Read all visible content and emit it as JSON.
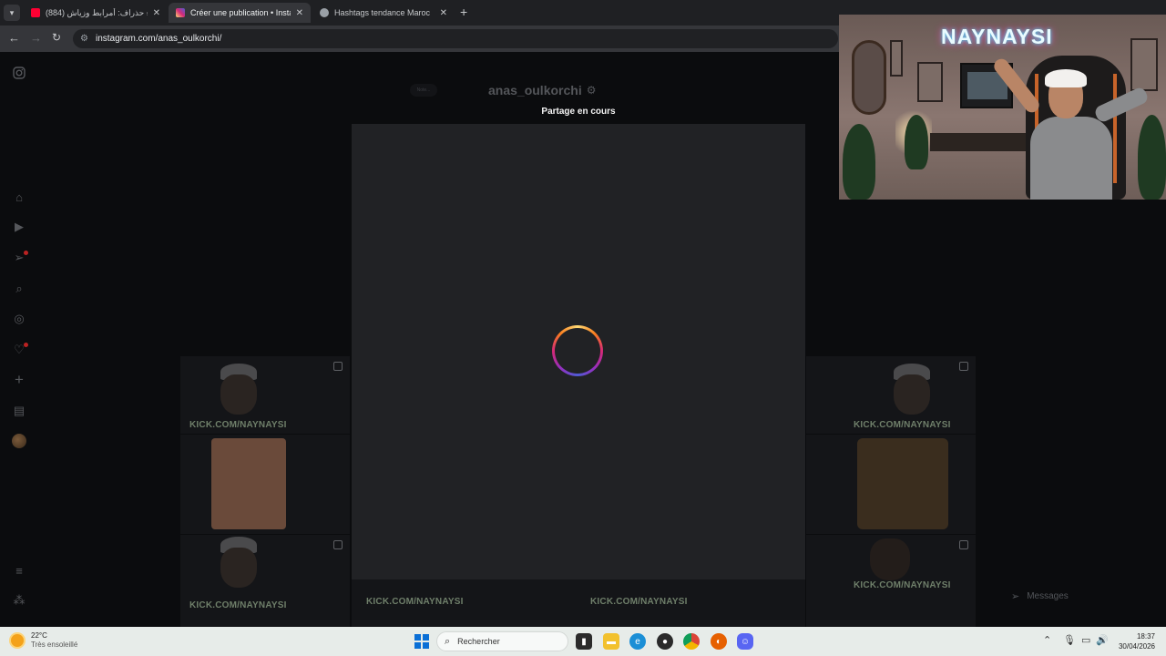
{
  "browser": {
    "tabs": [
      {
        "title": "(884) زكرياء حذراف: أمرابط وزياش",
        "active": false,
        "favicon_color": "#ff0033"
      },
      {
        "title": "Créer une publication • Instagram",
        "active": true,
        "favicon_color": "#d62976"
      },
      {
        "title": "Hashtags tendance Maroc",
        "active": false,
        "favicon_color": "#9aa0a6"
      }
    ],
    "new_tab_label": "+",
    "url": "instagram.com/anas_oulkorchi/"
  },
  "instagram": {
    "username": "anas_oulkorchi",
    "note_placeholder": "Note...",
    "modal_title": "Partage en cours",
    "watermark": "KICK.COM/NAYNAYSI",
    "messages_label": "Messages",
    "sidebar_icons": [
      "instagram-logo-icon",
      "home-icon",
      "reels-icon",
      "messages-icon",
      "search-icon",
      "explore-icon",
      "notifications-icon",
      "create-icon",
      "dashboard-icon",
      "profile-avatar",
      "menu-icon",
      "threads-icon"
    ]
  },
  "webcam": {
    "brand": "NAYNAYSI"
  },
  "taskbar": {
    "temperature": "22°C",
    "weather": "Très ensoleillé",
    "search_placeholder": "Rechercher",
    "time": "18:37",
    "date": "30/04/2026"
  },
  "colors": {
    "page_bg": "#0b0c0e",
    "modal_bg": "#212225",
    "taskbar_bg": "#e7ece9",
    "windows_blue": "#0a6fd6"
  }
}
